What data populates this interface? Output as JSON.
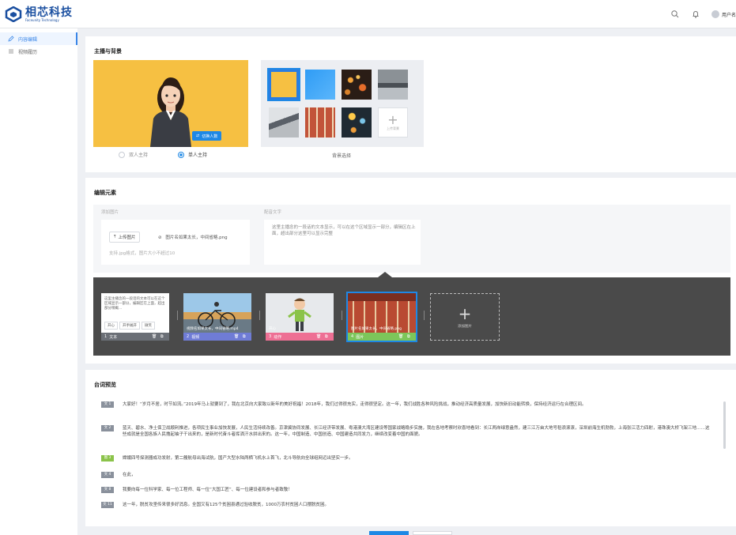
{
  "header": {
    "logo_cn": "相芯科技",
    "logo_en": "Faceunity Technology",
    "username": "用户名"
  },
  "sidebar": {
    "items": [
      {
        "label": "内容编辑",
        "active": true
      },
      {
        "label": "视频履历",
        "active": false
      }
    ]
  },
  "host_section": {
    "title": "主播与背景",
    "switch_button": "切换人数",
    "options": [
      {
        "label": "双人主持",
        "selected": false
      },
      {
        "label": "单人主持",
        "selected": true
      }
    ],
    "bg_caption": "背景选择",
    "upload_bg_label": "上传背景"
  },
  "edit_section": {
    "title": "编辑元素",
    "add_image_label": "添加图片",
    "upload_button": "上传图片",
    "file_name": "图片名如果太长，中间省略.png",
    "upload_hint": "支持.jpg格式，图片大小不超过10",
    "caption_label": "配音文字",
    "caption_text": "这里主播念的一段话的文本显示，可以在这个区域显示一部分，编辑区在上面，超出部分这里可以显示完整",
    "clips": [
      {
        "num": "1",
        "type": "文本",
        "text": "这里主播念的一段话的文本可以在这个区域显示一部分，编辑区在上面，超出部分稍概...",
        "buttons": [
          "开心",
          "开手摊开",
          "微笑"
        ],
        "color": "#6b6f76"
      },
      {
        "num": "2",
        "type": "视频",
        "label": "视频名如果太长，中间省略.mp4",
        "color": "#6f7cd6"
      },
      {
        "num": "3",
        "type": "动作",
        "label": "开心",
        "color": "#ee6f94"
      },
      {
        "num": "4",
        "type": "图片",
        "label": "图片名如果太长，中间省略.png",
        "color": "#7cc65a"
      }
    ],
    "add_clip_label": "添加图片"
  },
  "preview_section": {
    "title": "台词预览",
    "lines": [
      {
        "badge": "文 1",
        "kind": "gray",
        "text": "大家好！“岁月不居，时节如流。”2019年马上就要到了，我在北京向大家致以新年的美好祝福！2018年，我们过得很充实，走得很坚定。这一年，我们战胜各种风险挑战，推动经济高质量发展，加快新旧动能转换，保持经济运行在合理区间。"
      },
      {
        "badge": "文 2",
        "kind": "gray",
        "text": "蓝天、碧水、净土保卫战顺利推进，各项民生事业加快发展，人民生活持续改善。京津冀协同发展、长江经济带发展、粤港澳大湾区建设等国家战略稳步实施，我在各地考察时欣喜地看到：长江两岸绿意盎然，建三江万亩大地号稻浪滚滚，深圳前海生机勃勃，上海张江活力四射，港珠澳大桥飞架三地……这些成就是全国各族人民撸起袖子干出来的，是新时代奋斗者挥洒汗水拼出来的。这一年，中国制造、中国创造、中国建造共同发力，继续改变着中国的面貌。"
      },
      {
        "badge": "图 3",
        "kind": "green",
        "text": "嫦娥四号探测器成功发射，第二艘航母出海试航，国产大型水陆两栖飞机水上首飞，北斗导航向全球组网迈出坚实一步。"
      },
      {
        "badge": "文 4",
        "kind": "gray",
        "text": "在此，"
      },
      {
        "badge": "文 8",
        "kind": "gray",
        "text": "我要向每一位科学家、每一位工程师、每一位“大国工匠”、每一位建设者和参与者致敬！"
      },
      {
        "badge": "文 11",
        "kind": "gray",
        "text": "这一年，脱贫攻坚传来很多好消息。全国又有125个贫困县通过验收脱贫，1000万农村贫困人口摆脱贫困。"
      }
    ]
  },
  "colors": {
    "accent": "#1e88e5",
    "logo": "#1a4fa0",
    "stage_bg": "#f6c042"
  }
}
